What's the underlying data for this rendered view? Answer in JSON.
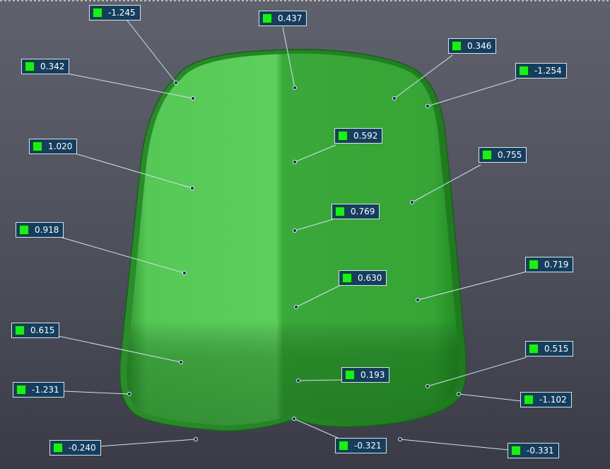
{
  "colors": {
    "swatch": "#1bee1b",
    "model_light": "#5dd05d",
    "model_mid": "#3ba83b",
    "model_dark": "#1f8a1f",
    "label_bg": "#153e5e",
    "leader": "#cfe3ef"
  },
  "annotations": [
    {
      "id": "a1",
      "value": "-1.245"
    },
    {
      "id": "a2",
      "value": "0.437"
    },
    {
      "id": "a3",
      "value": "0.342"
    },
    {
      "id": "a4",
      "value": "0.346"
    },
    {
      "id": "a5",
      "value": "-1.254"
    },
    {
      "id": "a6",
      "value": "1.020"
    },
    {
      "id": "a7",
      "value": "0.592"
    },
    {
      "id": "a8",
      "value": "0.755"
    },
    {
      "id": "a9",
      "value": "0.769"
    },
    {
      "id": "a10",
      "value": "0.918"
    },
    {
      "id": "a11",
      "value": "0.630"
    },
    {
      "id": "a12",
      "value": "0.719"
    },
    {
      "id": "a13",
      "value": "0.615"
    },
    {
      "id": "a14",
      "value": "0.515"
    },
    {
      "id": "a15",
      "value": "0.193"
    },
    {
      "id": "a16",
      "value": "-1.231"
    },
    {
      "id": "a17",
      "value": "-1.102"
    },
    {
      "id": "a18",
      "value": "-0.240"
    },
    {
      "id": "a19",
      "value": "-0.321"
    },
    {
      "id": "a20",
      "value": "-0.331"
    }
  ]
}
